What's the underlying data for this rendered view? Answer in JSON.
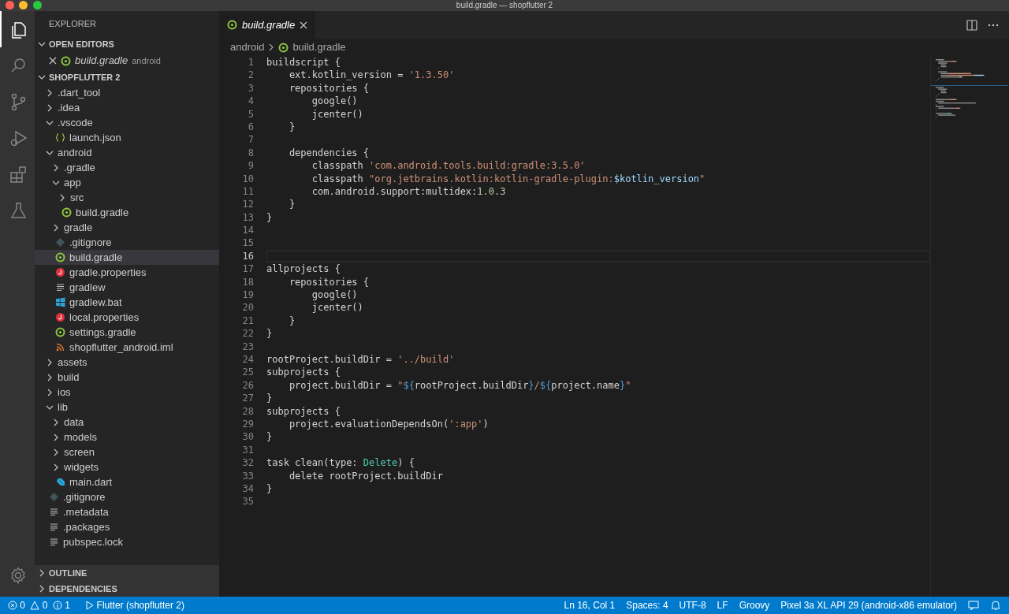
{
  "window": {
    "title": "build.gradle — shopflutter 2"
  },
  "activity_bar": [
    {
      "kind": "files",
      "selected": true
    },
    {
      "kind": "search",
      "selected": false
    },
    {
      "kind": "scm",
      "selected": false
    },
    {
      "kind": "run",
      "selected": false
    },
    {
      "kind": "extensions",
      "selected": false
    },
    {
      "kind": "flask",
      "selected": false
    }
  ],
  "sidebar": {
    "title": "EXPLORER",
    "open_editors": {
      "title": "OPEN EDITORS",
      "expanded": true,
      "items": [
        {
          "name": "build.gradle",
          "folder": "android",
          "kind": "gradle"
        }
      ]
    },
    "folder": {
      "title": "SHOPFLUTTER 2",
      "expanded": true,
      "items": [
        {
          "name": ".dart_tool",
          "kind": "folder",
          "expanded": false,
          "selected": false
        },
        {
          "name": ".idea",
          "kind": "folder",
          "expanded": false,
          "selected": false
        },
        {
          "name": ".vscode",
          "kind": "folder",
          "expanded": true,
          "selected": false,
          "children": [
            {
              "name": "launch.json",
              "kind": "json",
              "selected": false
            }
          ]
        },
        {
          "name": "android",
          "kind": "folder",
          "expanded": true,
          "selected": false,
          "children": [
            {
              "name": ".gradle",
              "kind": "folder",
              "expanded": false,
              "selected": false
            },
            {
              "name": "app",
              "kind": "folder",
              "expanded": true,
              "selected": false,
              "children": [
                {
                  "name": "src",
                  "kind": "folder",
                  "expanded": false,
                  "selected": false
                },
                {
                  "name": "build.gradle",
                  "kind": "gradle",
                  "selected": false
                }
              ]
            },
            {
              "name": "gradle",
              "kind": "folder",
              "expanded": false,
              "selected": false
            },
            {
              "name": ".gitignore",
              "kind": "git",
              "selected": false
            },
            {
              "name": "build.gradle",
              "kind": "gradle",
              "selected": true
            },
            {
              "name": "gradle.properties",
              "kind": "properties",
              "selected": false
            },
            {
              "name": "gradlew",
              "kind": "text",
              "selected": false
            },
            {
              "name": "gradlew.bat",
              "kind": "windows",
              "selected": false
            },
            {
              "name": "local.properties",
              "kind": "properties",
              "selected": false
            },
            {
              "name": "settings.gradle",
              "kind": "gradle",
              "selected": false
            },
            {
              "name": "shopflutter_android.iml",
              "kind": "rss",
              "selected": false
            }
          ]
        },
        {
          "name": "assets",
          "kind": "folder",
          "expanded": false,
          "selected": false
        },
        {
          "name": "build",
          "kind": "folder",
          "expanded": false,
          "selected": false
        },
        {
          "name": "ios",
          "kind": "folder",
          "expanded": false,
          "selected": false
        },
        {
          "name": "lib",
          "kind": "folder",
          "expanded": true,
          "selected": false,
          "children": [
            {
              "name": "data",
              "kind": "folder",
              "expanded": false,
              "selected": false
            },
            {
              "name": "models",
              "kind": "folder",
              "expanded": false,
              "selected": false
            },
            {
              "name": "screen",
              "kind": "folder",
              "expanded": false,
              "selected": false
            },
            {
              "name": "widgets",
              "kind": "folder",
              "expanded": false,
              "selected": false
            },
            {
              "name": "main.dart",
              "kind": "dart",
              "selected": false
            }
          ]
        },
        {
          "name": ".gitignore",
          "kind": "git",
          "selected": false
        },
        {
          "name": ".metadata",
          "kind": "text",
          "selected": false
        },
        {
          "name": ".packages",
          "kind": "text",
          "selected": false
        },
        {
          "name": "pubspec.lock",
          "kind": "text",
          "selected": false
        }
      ]
    },
    "collapsed_sections": [
      {
        "title": "OUTLINE",
        "expanded": false
      },
      {
        "title": "DEPENDENCIES",
        "expanded": false
      }
    ]
  },
  "editor": {
    "tabs": [
      {
        "label": "build.gradle",
        "kind": "gradle",
        "selected": true,
        "preview": true
      }
    ],
    "breadcrumb": [
      {
        "label": "android",
        "kind": "folder"
      },
      {
        "label": "build.gradle",
        "kind": "gradle"
      }
    ],
    "lines": [
      {
        "number": "1",
        "tokens": [
          {
            "text": "buildscript {",
            "kind": "plain"
          }
        ]
      },
      {
        "number": "2",
        "tokens": [
          {
            "text": "    ext.kotlin_version = ",
            "kind": "plain"
          },
          {
            "text": "'1.3.50'",
            "kind": "string"
          }
        ]
      },
      {
        "number": "3",
        "tokens": [
          {
            "text": "    repositories {",
            "kind": "plain"
          }
        ]
      },
      {
        "number": "4",
        "tokens": [
          {
            "text": "        google()",
            "kind": "plain"
          }
        ]
      },
      {
        "number": "5",
        "tokens": [
          {
            "text": "        jcenter()",
            "kind": "plain"
          }
        ]
      },
      {
        "number": "6",
        "tokens": [
          {
            "text": "    }",
            "kind": "plain"
          }
        ]
      },
      {
        "number": "7"
      },
      {
        "number": "8",
        "tokens": [
          {
            "text": "    dependencies {",
            "kind": "plain"
          }
        ]
      },
      {
        "number": "9",
        "tokens": [
          {
            "text": "        classpath ",
            "kind": "plain"
          },
          {
            "text": "'com.android.tools.build:gradle:3.5.0'",
            "kind": "string"
          }
        ]
      },
      {
        "number": "10",
        "tokens": [
          {
            "text": "        classpath ",
            "kind": "plain"
          },
          {
            "text": "\"org.jetbrains.kotlin:kotlin-gradle-plugin:",
            "kind": "string"
          },
          {
            "text": "$kotlin_version",
            "kind": "variable"
          },
          {
            "text": "\"",
            "kind": "string"
          }
        ]
      },
      {
        "number": "11",
        "tokens": [
          {
            "text": "        com.android.support:multidex:",
            "kind": "plain"
          },
          {
            "text": "1.0.3",
            "kind": "number"
          }
        ]
      },
      {
        "number": "12",
        "tokens": [
          {
            "text": "    }",
            "kind": "plain"
          }
        ]
      },
      {
        "number": "13",
        "tokens": [
          {
            "text": "}",
            "kind": "plain"
          }
        ]
      },
      {
        "number": "14"
      },
      {
        "number": "15"
      },
      {
        "number": "16",
        "current": true
      },
      {
        "number": "17",
        "tokens": [
          {
            "text": "allprojects {",
            "kind": "plain"
          }
        ]
      },
      {
        "number": "18",
        "tokens": [
          {
            "text": "    repositories {",
            "kind": "plain"
          }
        ]
      },
      {
        "number": "19",
        "tokens": [
          {
            "text": "        google()",
            "kind": "plain"
          }
        ]
      },
      {
        "number": "20",
        "tokens": [
          {
            "text": "        jcenter()",
            "kind": "plain"
          }
        ]
      },
      {
        "number": "21",
        "tokens": [
          {
            "text": "    }",
            "kind": "plain"
          }
        ]
      },
      {
        "number": "22",
        "tokens": [
          {
            "text": "}",
            "kind": "plain"
          }
        ]
      },
      {
        "number": "23"
      },
      {
        "number": "24",
        "tokens": [
          {
            "text": "rootProject.buildDir = ",
            "kind": "plain"
          },
          {
            "text": "'../build'",
            "kind": "string"
          }
        ]
      },
      {
        "number": "25",
        "tokens": [
          {
            "text": "subprojects {",
            "kind": "plain"
          }
        ]
      },
      {
        "number": "26",
        "tokens": [
          {
            "text": "    project.buildDir = ",
            "kind": "plain"
          },
          {
            "text": "\"",
            "kind": "string"
          },
          {
            "text": "${",
            "kind": "punct"
          },
          {
            "text": "rootProject.buildDir",
            "kind": "plain"
          },
          {
            "text": "}",
            "kind": "punct"
          },
          {
            "text": "/",
            "kind": "string"
          },
          {
            "text": "${",
            "kind": "punct"
          },
          {
            "text": "project.name",
            "kind": "plain"
          },
          {
            "text": "}",
            "kind": "punct"
          },
          {
            "text": "\"",
            "kind": "string"
          }
        ]
      },
      {
        "number": "27",
        "tokens": [
          {
            "text": "}",
            "kind": "plain"
          }
        ]
      },
      {
        "number": "28",
        "tokens": [
          {
            "text": "subprojects {",
            "kind": "plain"
          }
        ]
      },
      {
        "number": "29",
        "tokens": [
          {
            "text": "    project.evaluationDependsOn(",
            "kind": "plain"
          },
          {
            "text": "':app'",
            "kind": "string"
          },
          {
            "text": ")",
            "kind": "plain"
          }
        ]
      },
      {
        "number": "30",
        "tokens": [
          {
            "text": "}",
            "kind": "plain"
          }
        ]
      },
      {
        "number": "31"
      },
      {
        "number": "32",
        "tokens": [
          {
            "text": "task clean(type: ",
            "kind": "plain"
          },
          {
            "text": "Delete",
            "kind": "type"
          },
          {
            "text": ") {",
            "kind": "plain"
          }
        ]
      },
      {
        "number": "33",
        "tokens": [
          {
            "text": "    delete rootProject.buildDir",
            "kind": "plain"
          }
        ]
      },
      {
        "number": "34",
        "tokens": [
          {
            "text": "}",
            "kind": "plain"
          }
        ]
      },
      {
        "number": "35"
      }
    ]
  },
  "status_bar": {
    "left": [
      {
        "kind": "errors",
        "text": "0"
      },
      {
        "kind": "warnings",
        "text": "0"
      },
      {
        "kind": "info",
        "text": "1"
      },
      {
        "kind": "run",
        "text": "Flutter (shopflutter 2)"
      }
    ],
    "right": [
      {
        "kind": "text",
        "text": "Ln 16, Col 1"
      },
      {
        "kind": "text",
        "text": "Spaces: 4"
      },
      {
        "kind": "text",
        "text": "UTF-8"
      },
      {
        "kind": "text",
        "text": "LF"
      },
      {
        "kind": "text",
        "text": "Groovy"
      },
      {
        "kind": "text",
        "text": "Pixel 3a XL API 29 (android-x86 emulator)"
      },
      {
        "kind": "feedback"
      },
      {
        "kind": "bell"
      }
    ]
  }
}
